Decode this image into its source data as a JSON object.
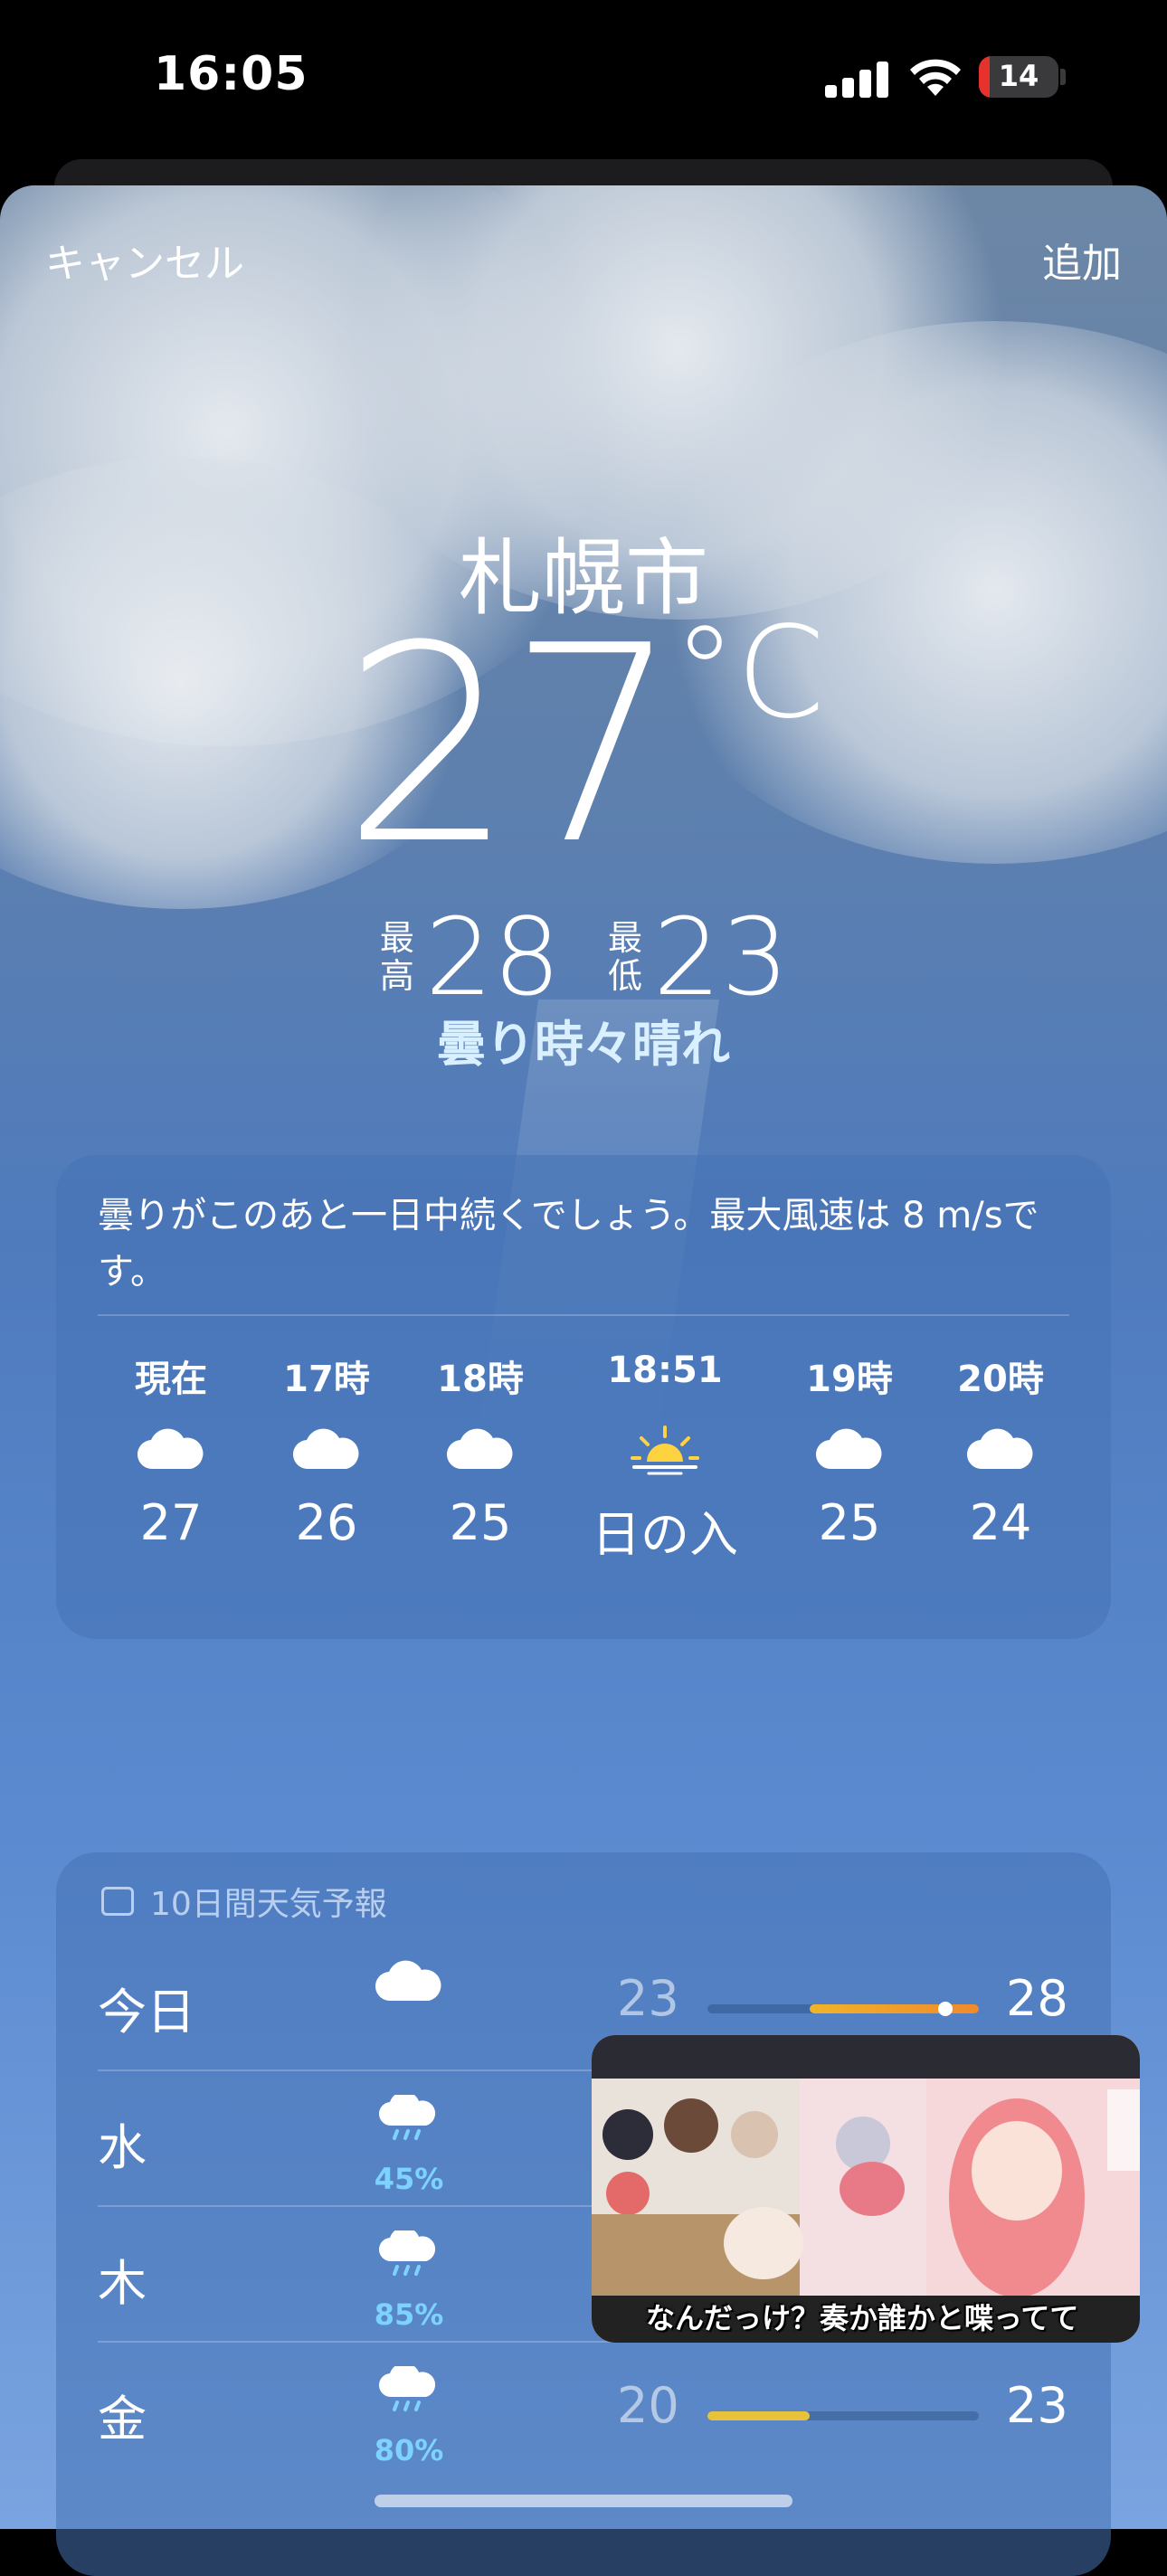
{
  "status_bar": {
    "time": "16:05",
    "battery": "14",
    "battery_level": 0.14
  },
  "nav": {
    "cancel": "キャンセル",
    "add": "追加"
  },
  "current": {
    "city": "札幌市",
    "temp": "27",
    "unit": "°C",
    "high_label": "最高",
    "high": "28",
    "low_label": "最低",
    "low": "23",
    "condition": "曇り時々晴れ"
  },
  "hourly": {
    "summary": "曇りがこのあと一日中続くでしょう。最大風速は 8 m/sです。",
    "items": [
      {
        "time": "現在",
        "icon": "cloud-icon",
        "value": "27"
      },
      {
        "time": "17時",
        "icon": "cloud-icon",
        "value": "26"
      },
      {
        "time": "18時",
        "icon": "cloud-icon",
        "value": "25"
      },
      {
        "time": "18:51",
        "icon": "sunset-icon",
        "value": "日の入"
      },
      {
        "time": "19時",
        "icon": "cloud-icon",
        "value": "25"
      },
      {
        "time": "20時",
        "icon": "cloud-icon",
        "value": "24"
      }
    ]
  },
  "forecast": {
    "title": "10日間天気予報",
    "scale": [
      20,
      28
    ],
    "days": [
      {
        "day": "今日",
        "icon": "cloud-icon",
        "pct": "",
        "low": "23",
        "high": "28",
        "range": [
          23,
          28
        ],
        "current": 27
      },
      {
        "day": "水",
        "icon": "rain-icon",
        "pct": "45%",
        "low": "",
        "high": "",
        "range": null
      },
      {
        "day": "木",
        "icon": "rain-icon",
        "pct": "85%",
        "low": "",
        "high": "",
        "range": null
      },
      {
        "day": "金",
        "icon": "rain-icon",
        "pct": "80%",
        "low": "20",
        "high": "23",
        "range": [
          20,
          23
        ]
      }
    ]
  },
  "pip": {
    "caption": "なんだっけ？奏か誰かと喋ってて"
  }
}
